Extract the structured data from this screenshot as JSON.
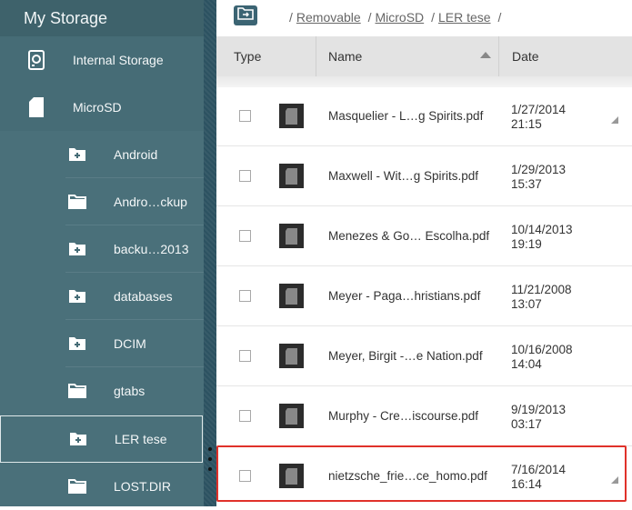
{
  "sidebar": {
    "title": "My Storage",
    "drives": [
      {
        "label": "Internal Storage",
        "icon": "internal-storage-icon"
      },
      {
        "label": "MicroSD",
        "icon": "sd-card-icon"
      }
    ],
    "folders": [
      {
        "label": "Android",
        "icon": "folder-plus-icon"
      },
      {
        "label": "Andro…ckup",
        "icon": "folder-icon"
      },
      {
        "label": "backu…2013",
        "icon": "folder-plus-icon"
      },
      {
        "label": "databases",
        "icon": "folder-plus-icon"
      },
      {
        "label": "DCIM",
        "icon": "folder-plus-icon"
      },
      {
        "label": "gtabs",
        "icon": "folder-icon"
      },
      {
        "label": "LER tese",
        "icon": "folder-plus-icon",
        "selected": true
      },
      {
        "label": "LOST.DIR",
        "icon": "folder-icon"
      }
    ]
  },
  "topbar": {
    "up_icon": "folder-up-icon",
    "breadcrumb": [
      "Removable",
      "MicroSD",
      "LER tese"
    ]
  },
  "table": {
    "headers": {
      "type": "Type",
      "name": "Name",
      "date": "Date"
    },
    "sort": "name-ascending",
    "rows": [
      {
        "name": "Masquelier - L…g Spirits.pdf",
        "date": "1/27/2014",
        "time": "21:15"
      },
      {
        "name": "Maxwell - Wit…g Spirits.pdf",
        "date": "1/29/2013",
        "time": "15:37"
      },
      {
        "name": "Menezes & Go… Escolha.pdf",
        "date": "10/14/2013",
        "time": "19:19"
      },
      {
        "name": "Meyer - Paga…hristians.pdf",
        "date": "11/21/2008",
        "time": "13:07"
      },
      {
        "name": "Meyer, Birgit -…e Nation.pdf",
        "date": "10/16/2008",
        "time": "14:04"
      },
      {
        "name": "Murphy - Cre…iscourse.pdf",
        "date": "9/19/2013",
        "time": "03:17"
      },
      {
        "name": "nietzsche_frie…ce_homo.pdf",
        "date": "7/16/2014",
        "time": "16:14",
        "highlighted": true
      }
    ]
  },
  "colors": {
    "sidebar_bg": "#466c76",
    "highlight": "#e0312a"
  }
}
